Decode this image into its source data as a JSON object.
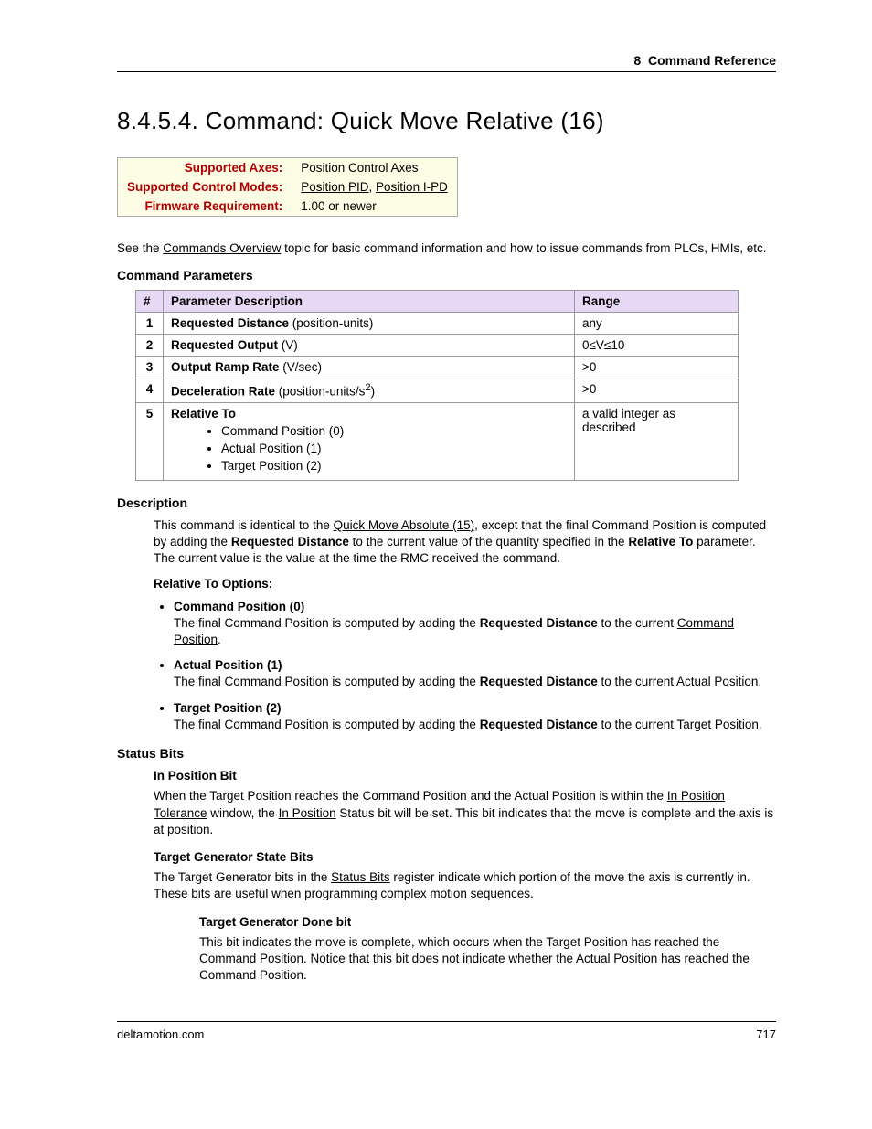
{
  "header": {
    "chapter": "8",
    "chapter_title": "Command Reference"
  },
  "title": {
    "num": "8.4.5.4.",
    "text": "Command: Quick Move Relative (16)"
  },
  "info": {
    "axes_label": "Supported Axes:",
    "axes_value": "Position Control Axes",
    "modes_label": "Supported Control Modes:",
    "modes_link1": "Position PID",
    "modes_sep": ", ",
    "modes_link2": "Position I-PD",
    "fw_label": "Firmware Requirement:",
    "fw_value": "1.00 or newer"
  },
  "intro": {
    "pre": "See the ",
    "link": "Commands Overview",
    "post": " topic for basic command information and how to issue commands from PLCs, HMIs, etc."
  },
  "params_heading": "Command Parameters",
  "param_table": {
    "h1": "#",
    "h2": "Parameter Description",
    "h3": "Range",
    "r1": {
      "n": "1",
      "b": "Requested Distance",
      "extra": " (position-units)",
      "range": "any"
    },
    "r2": {
      "n": "2",
      "b": "Requested Output",
      "extra": " (V)",
      "range": "0≤V≤10"
    },
    "r3": {
      "n": "3",
      "b": "Output Ramp Rate",
      "extra": " (V/sec)",
      "range": ">0"
    },
    "r4": {
      "n": "4",
      "b": "Deceleration Rate",
      "extra": "  (position-units/s",
      "sup": "2",
      "close": ")",
      "range": ">0"
    },
    "r5": {
      "n": "5",
      "b": "Relative To",
      "li1": "Command Position (0)",
      "li2": "Actual Position (1)",
      "li3": "Target Position (2)",
      "range": "a valid integer as described"
    }
  },
  "desc_heading": "Description",
  "desc": {
    "p1a": "This command is identical to the ",
    "p1link": "Quick Move Absolute (15)",
    "p1b": ", except that the final Command Position is computed by adding the ",
    "p1bold1": "Requested Distance",
    "p1c": " to the current value of the quantity specified in the ",
    "p1bold2": "Relative To",
    "p1d": " parameter. The current value is the value at the time the RMC received the command.",
    "rel_heading": "Relative To Options:",
    "opt1t": "Command Position (0)",
    "opt1a": "The final Command Position is computed by adding the ",
    "opt1b": "Requested Distance",
    "opt1c": " to the current ",
    "opt1link": "Command Position",
    "opt1d": ".",
    "opt2t": "Actual Position (1)",
    "opt2a": "The final Command Position is computed by adding the ",
    "opt2b": "Requested Distance",
    "opt2c": " to the current ",
    "opt2link": "Actual Position",
    "opt2d": ".",
    "opt3t": "Target Position (2)",
    "opt3a": "The final Command Position is computed by adding the ",
    "opt3b": "Requested Distance",
    "opt3c": " to the current ",
    "opt3link": "Target Position",
    "opt3d": "."
  },
  "status_heading": "Status Bits",
  "status": {
    "sub1": "In Position Bit",
    "p1a": "When the Target Position reaches the Command Position and the Actual Position is within the ",
    "p1link1": "In Position Tolerance",
    "p1b": " window, the ",
    "p1link2": "In Position",
    "p1c": " Status bit will be set. This bit indicates that the move is complete and the axis is at position.",
    "sub2": "Target Generator State Bits",
    "p2a": "The Target Generator bits in the ",
    "p2link": "Status Bits",
    "p2b": " register indicate which portion of the move the axis is currently in. These bits are useful when programming complex motion sequences.",
    "sub3": "Target Generator Done bit",
    "p3": "This bit indicates the move is complete, which occurs when the Target Position has reached the Command Position. Notice that this bit does not indicate whether the Actual Position has reached the Command Position."
  },
  "footer": {
    "left": "deltamotion.com",
    "right": "717"
  }
}
